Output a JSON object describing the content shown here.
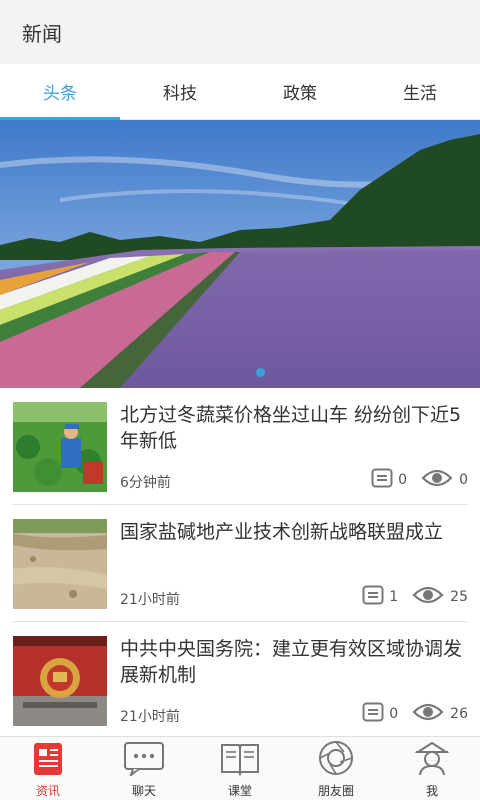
{
  "app": {
    "title": "新闻"
  },
  "tabs": [
    {
      "label": "头条",
      "active": true
    },
    {
      "label": "科技",
      "active": false
    },
    {
      "label": "政策",
      "active": false
    },
    {
      "label": "生活",
      "active": false
    }
  ],
  "banner": {
    "pages": 1,
    "current": 1
  },
  "news": [
    {
      "headline": "北方过冬蔬菜价格坐过山车 纷纷创下近5年新低",
      "time": "6分钟前",
      "comments": "0",
      "views": "0"
    },
    {
      "headline": "国家盐碱地产业技术创新战略联盟成立",
      "time": "21小时前",
      "comments": "1",
      "views": "25"
    },
    {
      "headline": "中共中央国务院：建立更有效区域协调发展新机制",
      "time": "21小时前",
      "comments": "0",
      "views": "26"
    }
  ],
  "nav": [
    {
      "label": "资讯",
      "icon": "news-icon",
      "active": true
    },
    {
      "label": "聊天",
      "icon": "chat-icon",
      "active": false
    },
    {
      "label": "课堂",
      "icon": "book-icon",
      "active": false
    },
    {
      "label": "朋友圈",
      "icon": "moments-icon",
      "active": false
    },
    {
      "label": "我",
      "icon": "profile-icon",
      "active": false
    }
  ],
  "colors": {
    "accent": "#3aa0df",
    "nav_active": "#e53935",
    "appbar": "#f3f3f3"
  }
}
